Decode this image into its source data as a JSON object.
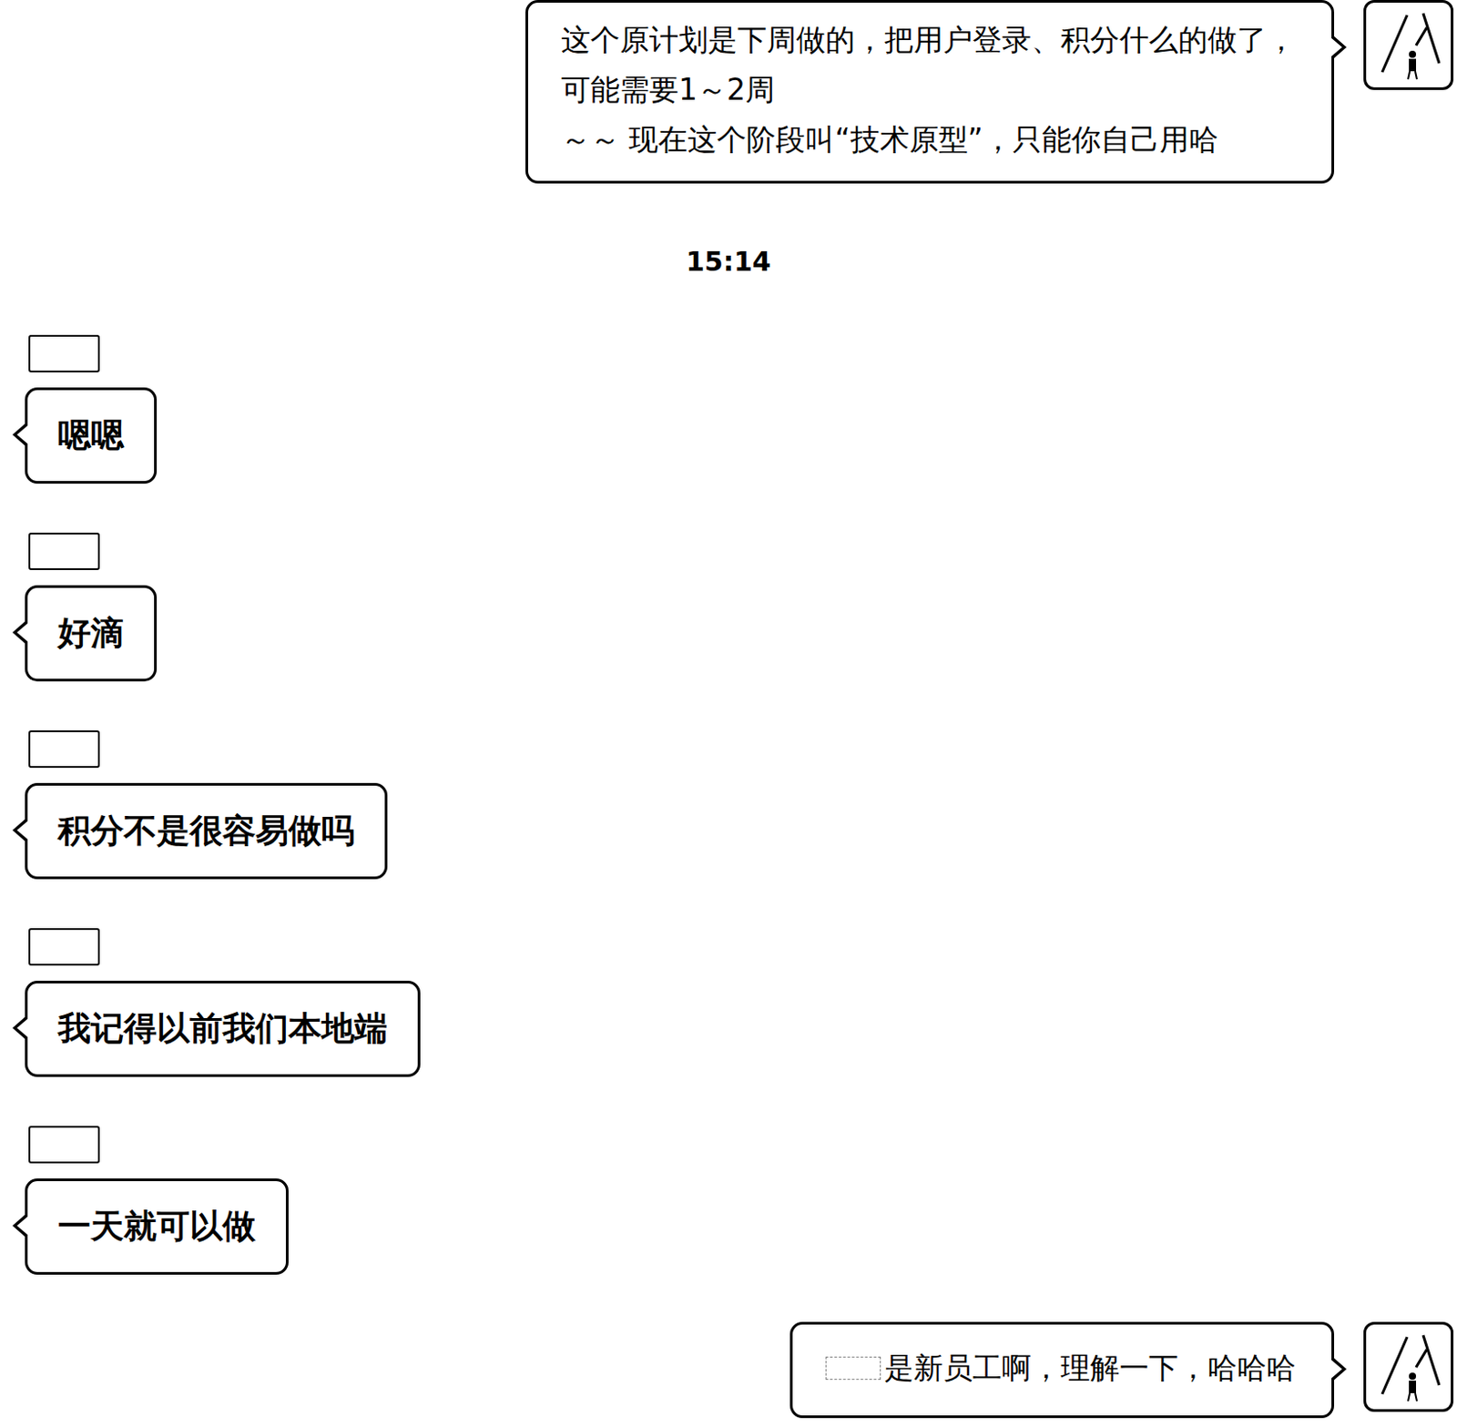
{
  "chat": {
    "messages": [
      {
        "side": "right",
        "name_redacted": false,
        "redacted_prefix": false,
        "lines": [
          "这个原计划是下周做的，把用户登录、积分什么的做了，",
          "可能需要1～2周",
          "～～ 现在这个阶段叫“技术原型”，只能你自己用哈"
        ]
      },
      {
        "side": "time",
        "lines": [
          "15:14"
        ]
      },
      {
        "side": "left",
        "name_redacted": true,
        "redacted_prefix": false,
        "lines": [
          "嗯嗯"
        ]
      },
      {
        "side": "left",
        "name_redacted": true,
        "redacted_prefix": false,
        "lines": [
          "好滴"
        ]
      },
      {
        "side": "left",
        "name_redacted": true,
        "redacted_prefix": false,
        "lines": [
          "积分不是很容易做吗"
        ]
      },
      {
        "side": "left",
        "name_redacted": true,
        "redacted_prefix": false,
        "lines": [
          "我记得以前我们本地端"
        ]
      },
      {
        "side": "left",
        "name_redacted": true,
        "redacted_prefix": false,
        "lines": [
          "一天就可以做"
        ]
      },
      {
        "side": "right",
        "name_redacted": false,
        "redacted_prefix": true,
        "lines": [
          "是新员工啊，理解一下，哈哈哈"
        ]
      }
    ]
  }
}
